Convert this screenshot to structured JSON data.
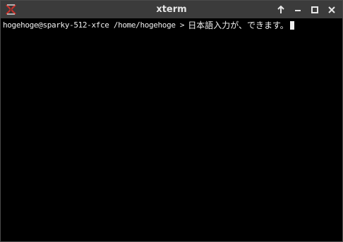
{
  "window": {
    "title": "xterm",
    "app_icon": "xterm-x-icon",
    "buttons": [
      {
        "name": "keep-above-button",
        "icon": "arrow-up-icon"
      },
      {
        "name": "minimize-button",
        "icon": "minimize-icon"
      },
      {
        "name": "maximize-button",
        "icon": "maximize-icon"
      },
      {
        "name": "close-button",
        "icon": "close-icon"
      }
    ]
  },
  "terminal": {
    "prompt": "hogehoge@sparky-512-xfce /home/hogehoge >",
    "input": "日本語入力が、できます。",
    "background": "#000000",
    "foreground": "#f0f0f0"
  },
  "colors": {
    "titlebar": "#3b3b3b",
    "title_text": "#e6e6e6",
    "icon_red": "#c8302a"
  }
}
